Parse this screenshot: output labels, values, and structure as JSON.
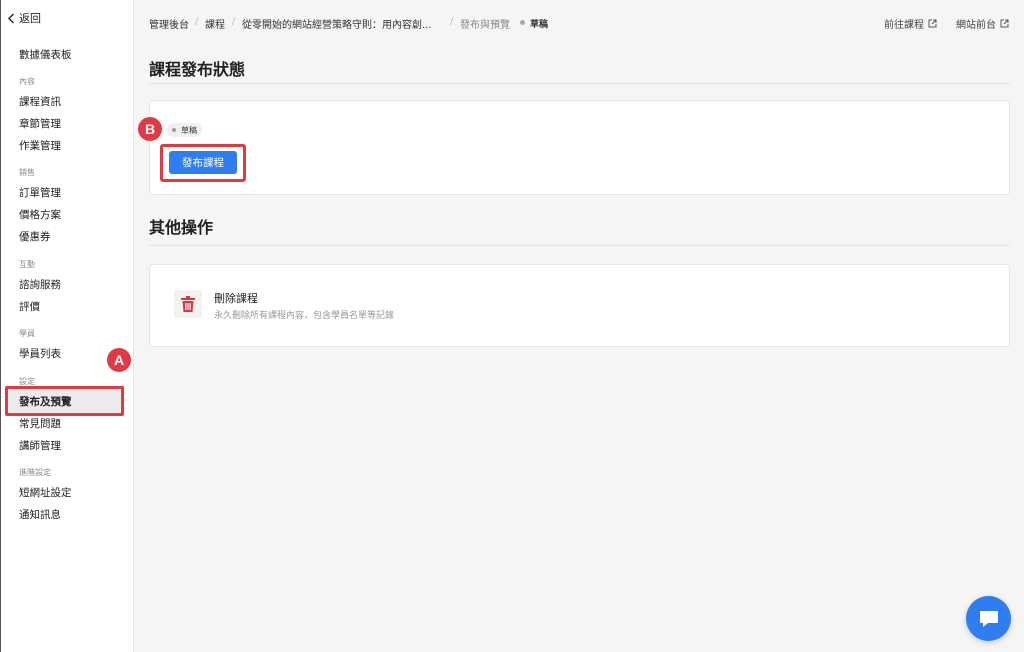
{
  "sidebar": {
    "back_label": "返回",
    "dashboard": "數據儀表板",
    "groups": {
      "content": "內容",
      "sales": "銷售",
      "interaction": "互動",
      "students": "學員",
      "settings": "設定",
      "advanced": "進階設定"
    },
    "items": {
      "course_info": "課程資訊",
      "chapters": "章節管理",
      "assignments": "作業管理",
      "orders": "訂單管理",
      "pricing": "價格方案",
      "coupons": "優惠券",
      "consulting": "諮詢服務",
      "reviews": "評價",
      "student_list": "學員列表",
      "publish_preview": "發布及預覽",
      "faq": "常見問題",
      "instructors": "講師管理",
      "short_url": "短網址設定",
      "notifications": "通知訊息"
    }
  },
  "breadcrumb": {
    "admin": "管理後台",
    "courses": "課程",
    "course_name": "從零開始的網站經營策略守則：用內容創...",
    "current": "發布與預覽",
    "status": "草稿",
    "separator": "/"
  },
  "top_links": {
    "go_course": "前往課程",
    "site_front": "網站前台"
  },
  "publish_section": {
    "title": "課程發布狀態",
    "status_chip": "草稿",
    "publish_button": "發布課程"
  },
  "other_section": {
    "title": "其他操作",
    "delete_title": "刪除課程",
    "delete_desc": "永久刪除所有課程內容，包含學員名單等記錄"
  },
  "annotations": {
    "a": "A",
    "b": "B"
  },
  "colors": {
    "accent": "#2f7ef0",
    "highlight": "#e03a45",
    "danger": "#d9363e"
  }
}
